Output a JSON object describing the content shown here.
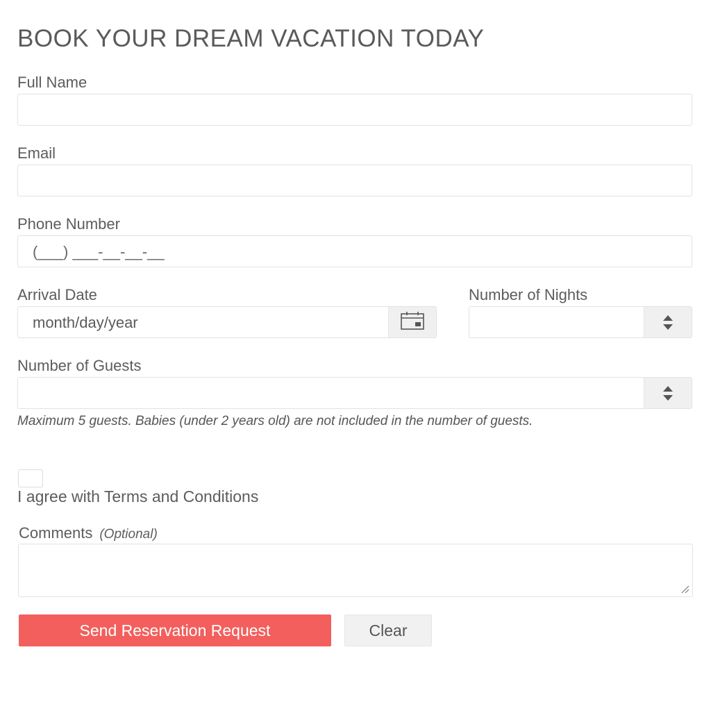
{
  "form": {
    "title": "BOOK YOUR DREAM VACATION TODAY",
    "full_name": {
      "label": "Full Name",
      "value": ""
    },
    "email": {
      "label": "Email",
      "value": ""
    },
    "phone": {
      "label": "Phone Number",
      "mask": "(___) ___-__-__-__"
    },
    "arrival_date": {
      "label": "Arrival Date",
      "placeholder": "month/day/year",
      "icon": "calendar-icon"
    },
    "nights": {
      "label": "Number of Nights",
      "value": "",
      "icon": "spinner-arrows-icon"
    },
    "guests": {
      "label": "Number of Guests",
      "value": "",
      "icon": "spinner-arrows-icon",
      "help": "Maximum 5 guests. Babies (under 2 years old) are not included in the number of guests."
    },
    "terms": {
      "label": "I agree with Terms and Conditions",
      "checked": false
    },
    "comments": {
      "label": "Comments",
      "optional": "(Optional)",
      "value": ""
    },
    "submit_label": "Send Reservation Request",
    "clear_label": "Clear"
  },
  "colors": {
    "primary": "#f25f5c",
    "text": "#555555",
    "border": "#e2e2e2",
    "button_gray": "#f1f1f1"
  }
}
